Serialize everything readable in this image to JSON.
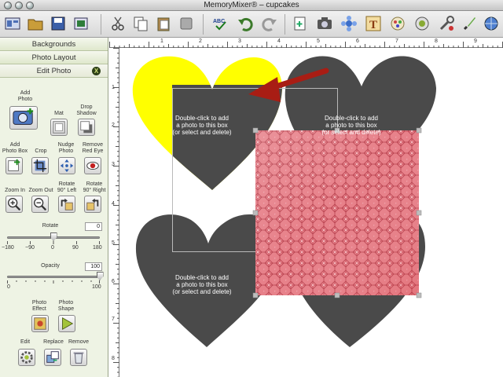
{
  "window": {
    "title": "MemoryMixer® – cupcakes"
  },
  "toolbar": {
    "icons": [
      "layout-icon",
      "open-folder-icon",
      "save-icon",
      "export-icon",
      "cut-icon",
      "copy-icon",
      "paste-icon",
      "delete-icon",
      "spellcheck-icon",
      "undo-icon",
      "redo-icon",
      "add-page-icon",
      "camera-icon",
      "embellishment-icon",
      "text-icon",
      "paper-icon",
      "stamp-icon",
      "tools-icon",
      "print-icon",
      "brush-icon",
      "globe-icon"
    ]
  },
  "panel": {
    "sections": {
      "backgrounds": "Backgrounds",
      "photo_layout": "Photo Layout",
      "edit_photo": "Edit Photo"
    },
    "close_label": "X",
    "labels": {
      "add_photo": "Add\nPhoto",
      "mat": "Mat",
      "drop_shadow": "Drop\nShadow",
      "add_photo_box": "Add\nPhoto Box",
      "crop": "Crop",
      "nudge_photo": "Nudge\nPhoto",
      "remove_red_eye": "Remove\nRed Eye",
      "zoom_in": "Zoom In",
      "zoom_out": "Zoom Out",
      "rotate_left": "Rotate\n90° Left",
      "rotate_right": "Rotate\n90° Right",
      "rotate": "Rotate",
      "opacity": "Opacity",
      "photo_effect": "Photo\nEffect",
      "photo_shape": "Photo\nShape",
      "edit": "Edit",
      "replace": "Replace",
      "remove": "Remove"
    },
    "rotate": {
      "value": "0",
      "ticks": [
        "−180",
        "−90",
        "0",
        "90",
        "180"
      ],
      "level_fraction": 0.5
    },
    "opacity": {
      "value": "100",
      "ticks": [
        "0",
        "100"
      ],
      "level_fraction": 1.0
    }
  },
  "rulers": {
    "top": [
      "1",
      "2",
      "3",
      "4",
      "5",
      "6",
      "7",
      "8",
      "9"
    ],
    "left": [
      "1",
      "2",
      "3",
      "4",
      "5",
      "6",
      "7",
      "8"
    ]
  },
  "canvas": {
    "placeholder_text": "Double-click to add\na photo to this box\n(or select and delete)",
    "colors": {
      "yellow_heart": "#ffff00",
      "gray_heart": "#4a4a4a",
      "arrow": "#a81d14",
      "paper": "#e37f86"
    }
  }
}
